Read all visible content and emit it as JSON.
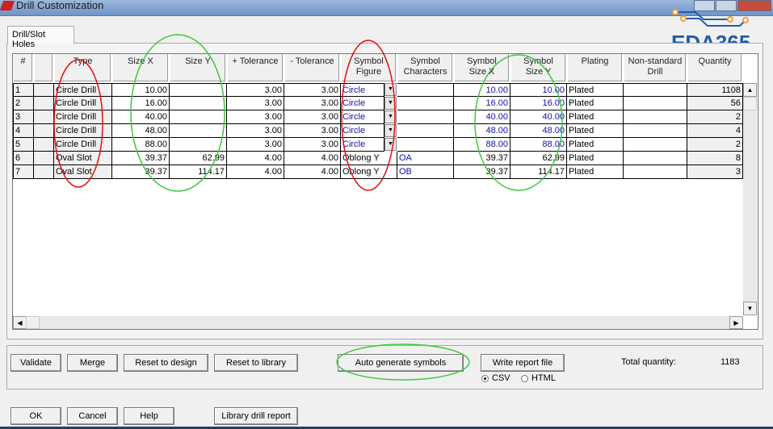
{
  "window": {
    "title": "Drill Customization"
  },
  "logo": {
    "text": "EDA365"
  },
  "tabs": [
    {
      "label": "Drill/Slot Holes"
    }
  ],
  "table": {
    "columns": [
      "#",
      "",
      "Type",
      "Size X",
      "Size Y",
      "+ Tolerance",
      "- Tolerance",
      "Symbol\nFigure",
      "Symbol\nCharacters",
      "Symbol\nSize X",
      "Symbol\nSize Y",
      "Plating",
      "Non-standard\nDrill",
      "Quantity"
    ],
    "rows": [
      {
        "num": "1",
        "type": "Circle Drill",
        "size_x": "10.00",
        "size_y": "",
        "tol_plus": "3.00",
        "tol_minus": "3.00",
        "symbol_figure": "Circle",
        "symbol_chars": "",
        "sym_size_x": "10.00",
        "sym_size_y": "10.00",
        "plating": "Plated",
        "nonstd": "",
        "qty": "1108"
      },
      {
        "num": "2",
        "type": "Circle Drill",
        "size_x": "16.00",
        "size_y": "",
        "tol_plus": "3.00",
        "tol_minus": "3.00",
        "symbol_figure": "Circle",
        "symbol_chars": "",
        "sym_size_x": "16.00",
        "sym_size_y": "16.00",
        "plating": "Plated",
        "nonstd": "",
        "qty": "56"
      },
      {
        "num": "3",
        "type": "Circle Drill",
        "size_x": "40.00",
        "size_y": "",
        "tol_plus": "3.00",
        "tol_minus": "3.00",
        "symbol_figure": "Circle",
        "symbol_chars": "",
        "sym_size_x": "40.00",
        "sym_size_y": "40.00",
        "plating": "Plated",
        "nonstd": "",
        "qty": "2"
      },
      {
        "num": "4",
        "type": "Circle Drill",
        "size_x": "48.00",
        "size_y": "",
        "tol_plus": "3.00",
        "tol_minus": "3.00",
        "symbol_figure": "Circle",
        "symbol_chars": "",
        "sym_size_x": "48.00",
        "sym_size_y": "48.00",
        "plating": "Plated",
        "nonstd": "",
        "qty": "4"
      },
      {
        "num": "5",
        "type": "Circle Drill",
        "size_x": "88.00",
        "size_y": "",
        "tol_plus": "3.00",
        "tol_minus": "3.00",
        "symbol_figure": "Circle",
        "symbol_chars": "",
        "sym_size_x": "88.00",
        "sym_size_y": "88.00",
        "plating": "Plated",
        "nonstd": "",
        "qty": "2"
      },
      {
        "num": "6",
        "type": "Oval Slot",
        "size_x": "39.37",
        "size_y": "62.99",
        "tol_plus": "4.00",
        "tol_minus": "4.00",
        "symbol_figure": "Oblong Y",
        "symbol_chars": "OA",
        "sym_size_x": "39.37",
        "sym_size_y": "62.99",
        "plating": "Plated",
        "nonstd": "",
        "qty": "8"
      },
      {
        "num": "7",
        "type": "Oval Slot",
        "size_x": "39.37",
        "size_y": "114.17",
        "tol_plus": "4.00",
        "tol_minus": "4.00",
        "symbol_figure": "Oblong Y",
        "symbol_chars": "OB",
        "sym_size_x": "39.37",
        "sym_size_y": "114.17",
        "plating": "Plated",
        "nonstd": "",
        "qty": "3"
      }
    ]
  },
  "actions": {
    "validate": "Validate",
    "merge": "Merge",
    "reset_design": "Reset to design",
    "reset_library": "Reset to library",
    "auto_generate": "Auto generate symbols",
    "write_report": "Write report file",
    "csv": "CSV",
    "html": "HTML",
    "report_format": "CSV",
    "total_label": "Total quantity:",
    "total_value": "1183"
  },
  "footer": {
    "ok": "OK",
    "cancel": "Cancel",
    "help": "Help",
    "library_report": "Library drill report"
  },
  "colors": {
    "annotation_red": "#e01010",
    "annotation_green": "#3ec83e",
    "blue_text": "#1010a8",
    "selection": "#3b8ee8"
  }
}
